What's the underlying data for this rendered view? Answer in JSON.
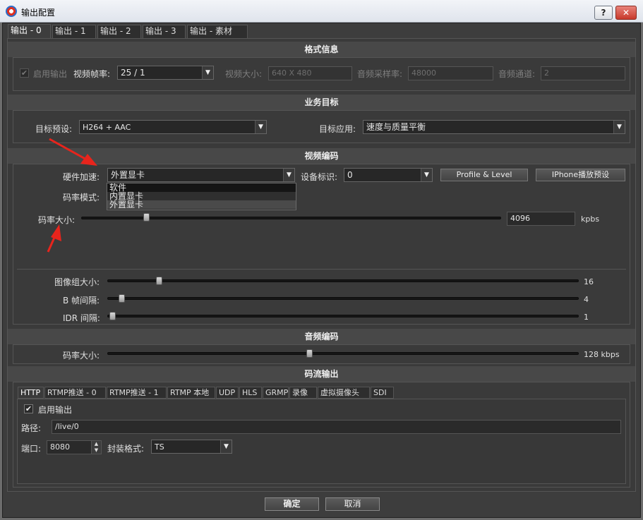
{
  "window": {
    "title": "输出配置",
    "help_label": "?",
    "close_label": "✕"
  },
  "output_tabs": [
    "输出 - 0",
    "输出 - 1",
    "输出 - 2",
    "输出 - 3",
    "输出 - 素材"
  ],
  "format": {
    "header": "格式信息",
    "enable_output": {
      "label": "启用输出",
      "checked": true
    },
    "frame_rate": {
      "label": "视频帧率:",
      "value": "25 / 1"
    },
    "video_size": {
      "label": "视频大小:",
      "value": "640 X 480"
    },
    "audio_rate": {
      "label": "音频采样率:",
      "value": "48000"
    },
    "audio_channels": {
      "label": "音频通道:",
      "value": "2"
    }
  },
  "business": {
    "header": "业务目标",
    "preset": {
      "label": "目标预设:",
      "value": "H264 + AAC"
    },
    "application": {
      "label": "目标应用:",
      "value": "速度与质量平衡"
    }
  },
  "video": {
    "header": "视频编码",
    "hw_accel": {
      "label": "硬件加速:",
      "value": "外置显卡",
      "options": [
        "软件",
        "内置显卡",
        "外置显卡"
      ]
    },
    "device_id": {
      "label": "设备标识:",
      "value": "0"
    },
    "profile_button": "Profile & Level",
    "iphone_button": "IPhone播放预设",
    "rate_mode_label": "码率模式:",
    "bitrate": {
      "label": "码率大小:",
      "value": "4096",
      "unit": "kpbs",
      "fraction": 0.155
    },
    "gop": {
      "label": "图像组大小:",
      "value": "16",
      "fraction": 0.11
    },
    "b_frame": {
      "label": "B 帧间隔:",
      "value": "4",
      "fraction": 0.03
    },
    "idr": {
      "label": "IDR 间隔:",
      "value": "1",
      "fraction": 0.01
    }
  },
  "audio": {
    "header": "音频编码",
    "bitrate": {
      "label": "码率大小:",
      "value": "128 kbps",
      "fraction": 0.428
    }
  },
  "stream": {
    "header": "码流输出",
    "tabs": [
      "HTTP",
      "RTMP推送 - 0",
      "RTMP推送 - 1",
      "RTMP 本地",
      "UDP",
      "HLS",
      "GRMP",
      "录像",
      "虚拟摄像头",
      "SDI"
    ],
    "enable_output": {
      "label": "启用输出",
      "checked": true
    },
    "path": {
      "label": "路径:",
      "value": "/live/0"
    },
    "port": {
      "label": "端口:",
      "value": "8080"
    },
    "container": {
      "label": "封装格式:",
      "value": "TS"
    }
  },
  "footer": {
    "ok_label": "确定",
    "cancel_label": "取消"
  },
  "colors": {
    "annotation_arrow": "#e8241c",
    "background": "#3d3d3d"
  }
}
